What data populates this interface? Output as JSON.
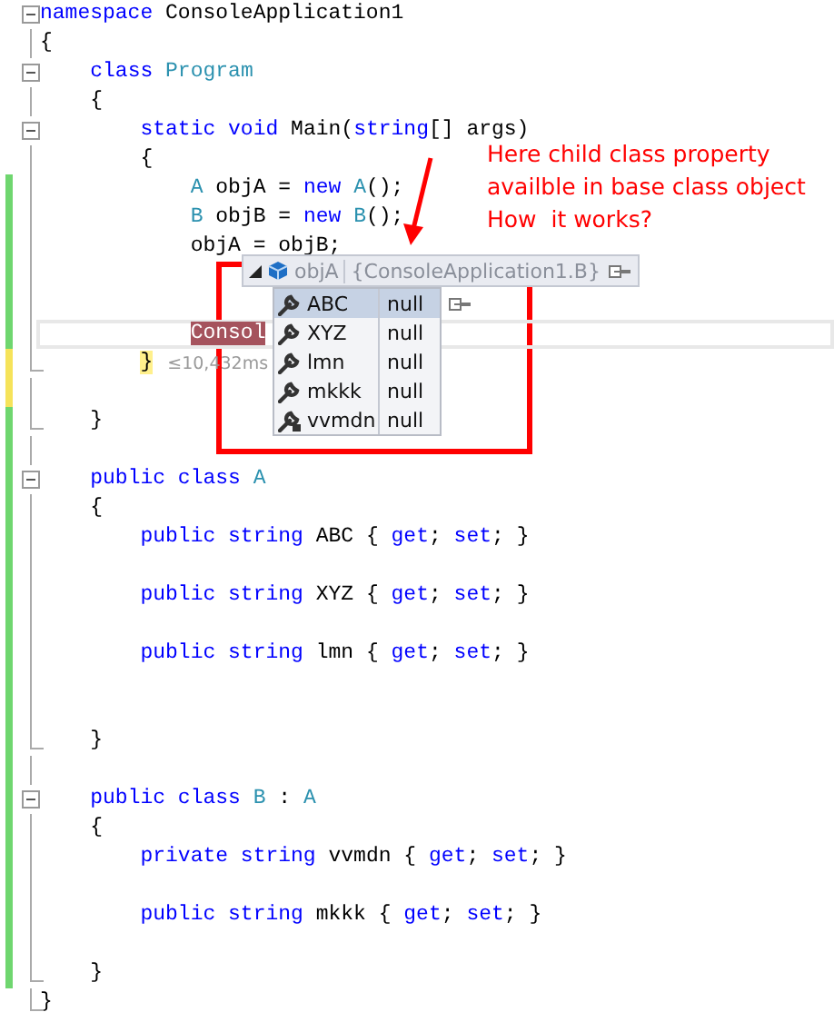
{
  "editor": {
    "lines": [
      {
        "kind": "fold-start",
        "current": false,
        "tokens": [
          {
            "kind": "keyword",
            "text": "namespace "
          },
          {
            "kind": "plain",
            "text": "ConsoleApplication1"
          }
        ]
      },
      {
        "kind": "body",
        "current": false,
        "tokens": [
          {
            "kind": "plain",
            "text": "{"
          }
        ]
      },
      {
        "kind": "fold-start",
        "current": false,
        "tokens": [
          {
            "kind": "keyword",
            "text": "    class "
          },
          {
            "kind": "type",
            "text": "Program"
          }
        ]
      },
      {
        "kind": "body",
        "current": false,
        "tokens": [
          {
            "kind": "plain",
            "text": "    {"
          }
        ]
      },
      {
        "kind": "fold-start",
        "current": false,
        "tokens": [
          {
            "kind": "keyword",
            "text": "        static void"
          },
          {
            "kind": "plain",
            "text": " Main("
          },
          {
            "kind": "keyword",
            "text": "string"
          },
          {
            "kind": "plain",
            "text": "[] args)"
          }
        ]
      },
      {
        "kind": "body",
        "current": false,
        "tokens": [
          {
            "kind": "plain",
            "text": "        {"
          }
        ]
      },
      {
        "kind": "body",
        "color": "#6fd66f",
        "current": false,
        "tokens": [
          {
            "kind": "type",
            "text": "            A"
          },
          {
            "kind": "plain",
            "text": " objA = "
          },
          {
            "kind": "keyword",
            "text": "new "
          },
          {
            "kind": "type",
            "text": "A"
          },
          {
            "kind": "plain",
            "text": "();"
          }
        ]
      },
      {
        "kind": "body",
        "color": "#6fd66f",
        "current": false,
        "tokens": [
          {
            "kind": "type",
            "text": "            B"
          },
          {
            "kind": "plain",
            "text": " objB = "
          },
          {
            "kind": "keyword",
            "text": "new "
          },
          {
            "kind": "type",
            "text": "B"
          },
          {
            "kind": "plain",
            "text": "();"
          }
        ]
      },
      {
        "kind": "body",
        "color": "#6fd66f",
        "current": false,
        "tokens": [
          {
            "kind": "plain",
            "text": "            objA = objB;"
          }
        ]
      },
      {
        "kind": "body",
        "color": "#6fd66f",
        "current": false
      },
      {
        "kind": "body",
        "color": "#6fd66f",
        "current": false
      },
      {
        "kind": "body",
        "color": "#6fd66f",
        "current": true,
        "tokens": [
          {
            "kind": "statement",
            "text": "            Consol"
          }
        ]
      },
      {
        "kind": "block-end",
        "color": "#f6e35a",
        "current": false,
        "tokens": [
          {
            "kind": "brace",
            "text": "        }"
          },
          {
            "kind": "perf",
            "text": "≤10,432ms"
          }
        ]
      },
      {
        "kind": "body",
        "color": "#f6e35a",
        "current": false
      },
      {
        "kind": "block-end",
        "color": "#6fd66f",
        "current": false,
        "tokens": [
          {
            "kind": "plain",
            "text": "    }"
          }
        ]
      },
      {
        "kind": "body",
        "color": "#6fd66f",
        "current": false
      },
      {
        "kind": "fold-start",
        "color": "#6fd66f",
        "current": false,
        "tokens": [
          {
            "kind": "keyword",
            "text": "    public class "
          },
          {
            "kind": "type",
            "text": "A"
          }
        ]
      },
      {
        "kind": "body",
        "color": "#6fd66f",
        "current": false,
        "tokens": [
          {
            "kind": "plain",
            "text": "    {"
          }
        ]
      },
      {
        "kind": "body",
        "color": "#6fd66f",
        "current": false,
        "tokens": [
          {
            "kind": "keyword",
            "text": "        public string"
          },
          {
            "kind": "plain",
            "text": " ABC { "
          },
          {
            "kind": "keyword",
            "text": "get"
          },
          {
            "kind": "plain",
            "text": "; "
          },
          {
            "kind": "keyword",
            "text": "set"
          },
          {
            "kind": "plain",
            "text": "; }"
          }
        ]
      },
      {
        "kind": "body",
        "color": "#6fd66f",
        "current": false
      },
      {
        "kind": "body",
        "color": "#6fd66f",
        "current": false,
        "tokens": [
          {
            "kind": "keyword",
            "text": "        public string"
          },
          {
            "kind": "plain",
            "text": " XYZ { "
          },
          {
            "kind": "keyword",
            "text": "get"
          },
          {
            "kind": "plain",
            "text": "; "
          },
          {
            "kind": "keyword",
            "text": "set"
          },
          {
            "kind": "plain",
            "text": "; }"
          }
        ]
      },
      {
        "kind": "body",
        "color": "#6fd66f",
        "current": false
      },
      {
        "kind": "body",
        "color": "#6fd66f",
        "current": false,
        "tokens": [
          {
            "kind": "keyword",
            "text": "        public string"
          },
          {
            "kind": "plain",
            "text": " lmn { "
          },
          {
            "kind": "keyword",
            "text": "get"
          },
          {
            "kind": "plain",
            "text": "; "
          },
          {
            "kind": "keyword",
            "text": "set"
          },
          {
            "kind": "plain",
            "text": "; }"
          }
        ]
      },
      {
        "kind": "body",
        "color": "#6fd66f",
        "current": false
      },
      {
        "kind": "body",
        "color": "#6fd66f",
        "current": false
      },
      {
        "kind": "block-end",
        "color": "#6fd66f",
        "current": false,
        "tokens": [
          {
            "kind": "plain",
            "text": "    }"
          }
        ]
      },
      {
        "kind": "body",
        "color": "#6fd66f",
        "current": false
      },
      {
        "kind": "fold-start",
        "color": "#6fd66f",
        "current": false,
        "tokens": [
          {
            "kind": "keyword",
            "text": "    public class "
          },
          {
            "kind": "type",
            "text": "B"
          },
          {
            "kind": "plain",
            "text": " : "
          },
          {
            "kind": "type",
            "text": "A"
          }
        ]
      },
      {
        "kind": "body",
        "color": "#6fd66f",
        "current": false,
        "tokens": [
          {
            "kind": "plain",
            "text": "    {"
          }
        ]
      },
      {
        "kind": "body",
        "color": "#6fd66f",
        "current": false,
        "tokens": [
          {
            "kind": "keyword",
            "text": "        private string"
          },
          {
            "kind": "plain",
            "text": " vvmdn { "
          },
          {
            "kind": "keyword",
            "text": "get"
          },
          {
            "kind": "plain",
            "text": "; "
          },
          {
            "kind": "keyword",
            "text": "set"
          },
          {
            "kind": "plain",
            "text": "; }"
          }
        ]
      },
      {
        "kind": "body",
        "color": "#6fd66f",
        "current": false
      },
      {
        "kind": "body",
        "color": "#6fd66f",
        "current": false,
        "tokens": [
          {
            "kind": "keyword",
            "text": "        public string"
          },
          {
            "kind": "plain",
            "text": " mkkk { "
          },
          {
            "kind": "keyword",
            "text": "get"
          },
          {
            "kind": "plain",
            "text": "; "
          },
          {
            "kind": "keyword",
            "text": "set"
          },
          {
            "kind": "plain",
            "text": "; }"
          }
        ]
      },
      {
        "kind": "body",
        "color": "#6fd66f",
        "current": false
      },
      {
        "kind": "block-end",
        "color": "#6fd66f",
        "current": false,
        "tokens": [
          {
            "kind": "plain",
            "text": "    }"
          }
        ]
      },
      {
        "kind": "block-end",
        "current": false,
        "tokens": [
          {
            "kind": "plain",
            "text": "}"
          }
        ]
      }
    ]
  },
  "datatip": {
    "name": "objA",
    "value": "{ConsoleApplication1.B}",
    "expanded": true,
    "members": [
      {
        "name": "ABC",
        "value": "null",
        "selected": true,
        "kind": "property"
      },
      {
        "name": "XYZ",
        "value": "null",
        "selected": false,
        "kind": "property"
      },
      {
        "name": "lmn",
        "value": "null",
        "selected": false,
        "kind": "property"
      },
      {
        "name": "mkkk",
        "value": "null",
        "selected": false,
        "kind": "property"
      },
      {
        "name": "vvmdn",
        "value": "null",
        "selected": false,
        "kind": "private-property"
      }
    ]
  },
  "annotation": {
    "note": [
      "Here child class property",
      "availble in base class object",
      "How  it works?"
    ]
  }
}
